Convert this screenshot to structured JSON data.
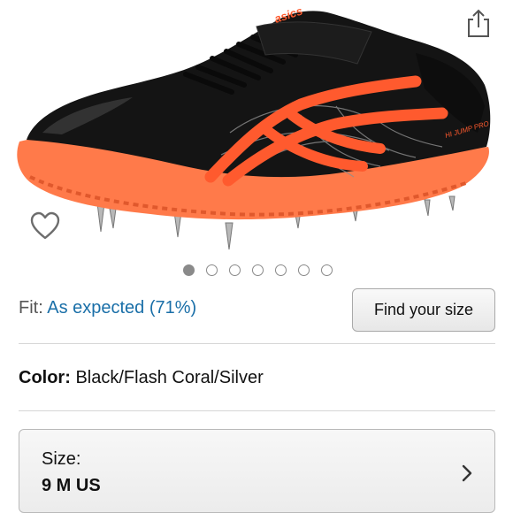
{
  "product": {
    "image_alt": "ASICS Hi Jump Pro track spike shoe in Black/Flash Coral/Silver",
    "image_text_brand": "asics",
    "image_text_model": "HI JUMP PRO",
    "carousel": {
      "total": 7,
      "active": 1
    }
  },
  "fit": {
    "label": "Fit:",
    "value": "As expected (71%)",
    "button_label": "Find your size"
  },
  "color": {
    "label": "Color:",
    "value": "Black/Flash Coral/Silver"
  },
  "size": {
    "label": "Size:",
    "value": "9 M US"
  },
  "icons": {
    "share": "share-icon",
    "wishlist": "heart-icon",
    "chevron": "chevron-right-icon"
  },
  "colors": {
    "link": "#1a6fa8",
    "coral": "#ff5a2e",
    "sole": "#ff7a4a",
    "shoe_black": "#141414"
  }
}
